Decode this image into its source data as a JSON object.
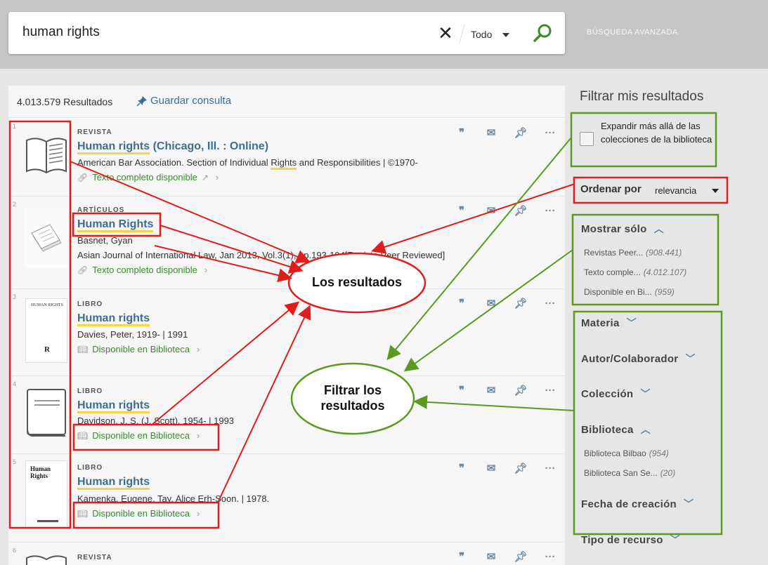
{
  "header": {
    "search_value": "human rights",
    "clear_label": "✕",
    "scope": "Todo",
    "advanced": "BÚSQUEDA AVANZADA"
  },
  "results_bar": {
    "count": "4.013.579 Resultados",
    "save_query": "Guardar consulta"
  },
  "items": [
    {
      "num": "1",
      "type": "REVISTA",
      "title": "Human rights",
      "title_rest": " (Chicago, Ill. : Online)",
      "line1_a": "American Bar Association. Section of Individual ",
      "line1_hl": "Rights",
      "line1_b": " and Responsibilities | ©1970-",
      "avail": "Texto completo disponible"
    },
    {
      "num": "2",
      "type": "ARTÍCULOS",
      "title": "Human Rights",
      "line1": "Basnet, Gyan",
      "line2": "Asian Journal of International Law, Jan 2013, Vol.3(1), pp.193-194[Revista Peer Reviewed]",
      "avail": "Texto completo disponible"
    },
    {
      "num": "3",
      "type": "LIBRO",
      "title": "Human rights",
      "line1": "Davies, Peter, 1919- | 1991",
      "avail": "Disponible en Biblioteca"
    },
    {
      "num": "4",
      "type": "LIBRO",
      "title": "Human rights",
      "line1": "Davidson, J. S. (J. Scott), 1954- | 1993",
      "avail": "Disponible en Biblioteca"
    },
    {
      "num": "5",
      "type": "LIBRO",
      "title": "Human rights",
      "line1": "Kamenka, Eugene. Tay, Alice Erh-Soon. | 1978.",
      "avail": "Disponible en Biblioteca"
    },
    {
      "num": "6",
      "type": "REVISTA"
    }
  ],
  "thumbs": {
    "item3_text": "HUMAN RIGHTS",
    "item5_text": "Human Rights"
  },
  "filters": {
    "title": "Filtrar mis resultados",
    "expand": "Expandir más allá de las colecciones de la biblioteca",
    "sort_label": "Ordenar por",
    "sort_value": "relevancia",
    "show_only": "Mostrar sólo",
    "show_only_items": [
      {
        "label": "Revistas Peer...",
        "count": "(908.441)"
      },
      {
        "label": "Texto comple...",
        "count": "(4.012.107)"
      },
      {
        "label": "Disponible en Bi...",
        "count": "(959)"
      }
    ],
    "materia": "Materia",
    "autor": "Autor/Colaborador",
    "coleccion": "Colección",
    "biblioteca": "Biblioteca",
    "biblioteca_items": [
      {
        "label": "Biblioteca Bilbao",
        "count": "(954)"
      },
      {
        "label": "Biblioteca San Se...",
        "count": "(20)"
      }
    ],
    "fecha": "Fecha de creación",
    "tipo": "Tipo de recurso"
  },
  "annotations": {
    "results_label": "Los resultados",
    "filter_label_1": "Filtrar los",
    "filter_label_2": "resultados"
  },
  "colors": {
    "link_blue": "#3d6e8f",
    "available_green": "#3c8a2e",
    "highlight_yellow": "#f5d547",
    "annotation_red": "#e21b1b",
    "annotation_green": "#5b9a1f"
  }
}
